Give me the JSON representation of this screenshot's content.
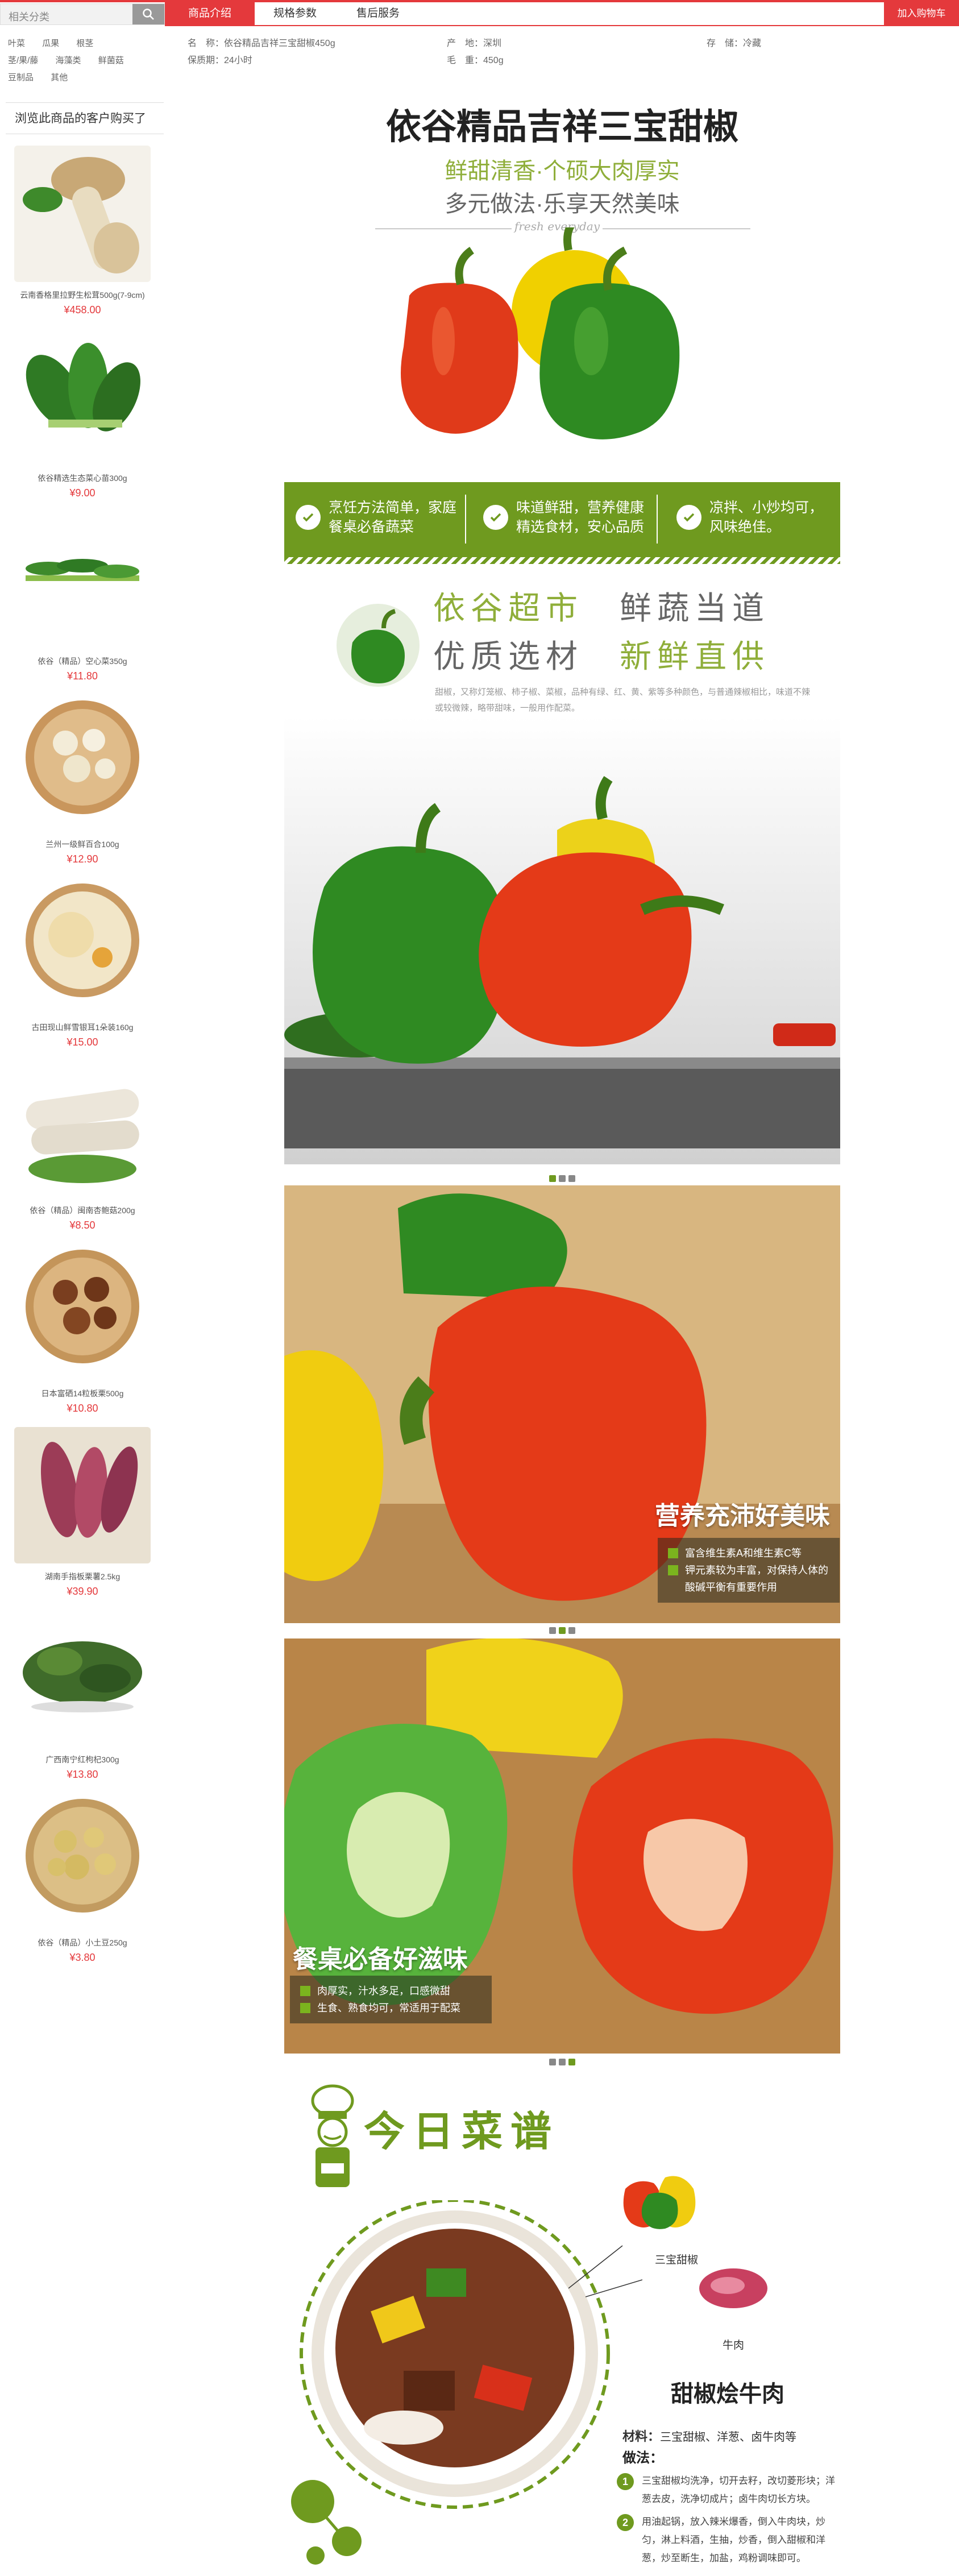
{
  "search": {
    "label": "相关分类"
  },
  "categories": [
    "叶菜",
    "瓜果",
    "根茎",
    "茎/果/藤",
    "海藻类",
    "鲜菌菇",
    "豆制品",
    "其他"
  ],
  "tabs": [
    "商品介绍",
    "规格参数",
    "售后服务"
  ],
  "cart_button": "加入购物车",
  "params": {
    "name": "名　称：依谷精品吉祥三宝甜椒450g",
    "origin": "产　地：深圳",
    "storage": "存　储：冷藏",
    "shelf": "保质期：24小时",
    "weight": "毛　重：450g"
  },
  "sidebar": {
    "title": "浏览此商品的客户购买了",
    "items": [
      {
        "name": "云南香格里拉野生松茸500g(7-9cm)",
        "price": "¥458.00"
      },
      {
        "name": "依谷精选生态菜心苗300g",
        "price": "¥9.00"
      },
      {
        "name": "依谷（精品）空心菜350g",
        "price": "¥11.80"
      },
      {
        "name": "兰州一级鲜百合100g",
        "price": "¥12.90"
      },
      {
        "name": "古田现山鲜雪银耳1朵装160g",
        "price": "¥15.00"
      },
      {
        "name": "依谷（精品）闽南杏鲍菇200g",
        "price": "¥8.50"
      },
      {
        "name": "日本富硒14粒板栗500g",
        "price": "¥10.80"
      },
      {
        "name": "湖南手指板栗薯2.5kg",
        "price": "¥39.90"
      },
      {
        "name": "广西南宁红枸杞300g",
        "price": "¥13.80"
      },
      {
        "name": "依谷（精品）小土豆250g",
        "price": "¥3.80"
      }
    ]
  },
  "hero": {
    "title": "依谷精品吉祥三宝甜椒",
    "sub1": "鲜甜清香·个硕大肉厚实",
    "sub2": "多元做法·乐享天然美味",
    "en": "fresh everyday"
  },
  "bar": [
    {
      "l1": "烹饪方法简单，家庭",
      "l2": "餐桌必备蔬菜"
    },
    {
      "l1": "味道鲜甜，营养健康",
      "l2": "精选食材，安心品质"
    },
    {
      "l1": "凉拌、小炒均可，",
      "l2": "风味绝佳。"
    }
  ],
  "sec2": {
    "row1a": "依谷超市",
    "row1b": "鲜蔬当道",
    "row2a": "优质选材",
    "row2b": "新鲜直供",
    "desc": "甜椒，又称灯笼椒、柿子椒、菜椒，品种有绿、红、黄、紫等多种颜色，与普通辣椒相比，味道不辣或较微辣，略带甜味，一般用作配菜。"
  },
  "panel3": {
    "title": "营养充沛好美味",
    "b1": "富含维生素A和维生素C等",
    "b2": "钾元素较为丰富，对保持人体的酸碱平衡有重要作用"
  },
  "panel4": {
    "title": "餐桌必备好滋味",
    "b1": "肉厚实，汁水多足，口感微甜",
    "b2": "生食、熟食均可，常适用于配菜"
  },
  "recipe": {
    "title": "今日菜谱",
    "ing1": "三宝甜椒",
    "ing2": "牛肉",
    "dish": "甜椒烩牛肉",
    "materials_label": "材料：",
    "materials": "三宝甜椒、洋葱、卤牛肉等",
    "method_label": "做法：",
    "steps": [
      "三宝甜椒均洗净，切开去籽，改切菱形块；洋葱去皮，洗净切成片；卤牛肉切长方块。",
      "用油起锅，放入辣米爆香，倒入牛肉块，炒匀，淋上料酒，生抽，炒香，倒入甜椒和洋葱，炒至断生，加盐，鸡粉调味即可。"
    ]
  },
  "colors": {
    "accent": "#e4393c",
    "green": "#6f9a1f",
    "price": "#e4393c"
  }
}
